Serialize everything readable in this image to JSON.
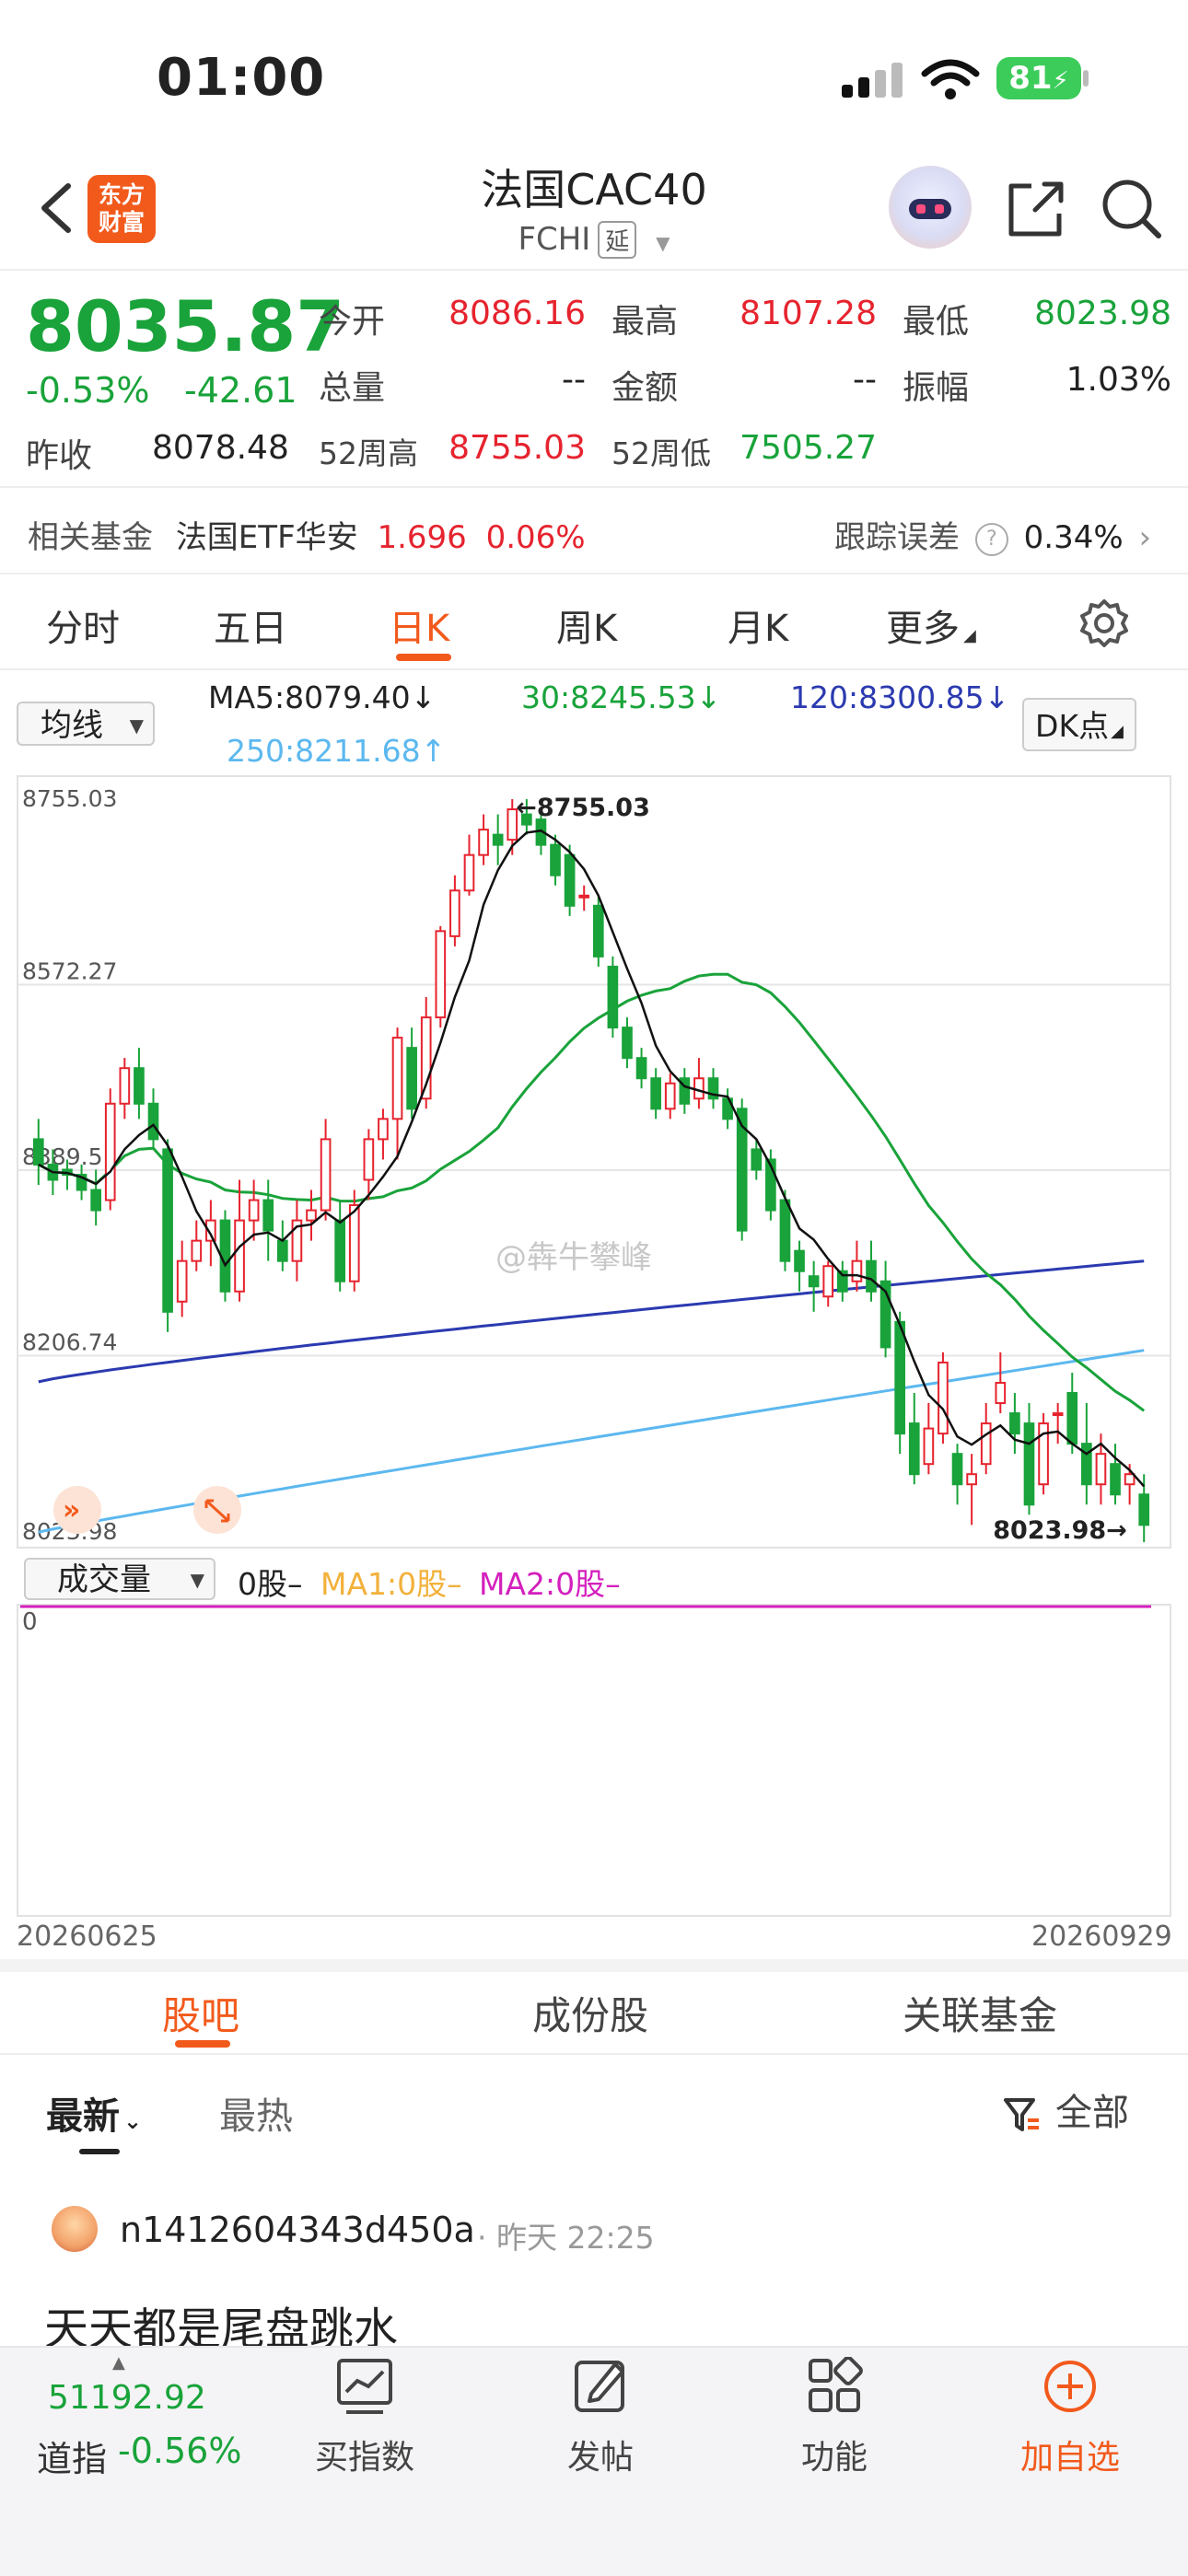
{
  "status_bar": {
    "time": "01:00",
    "battery": "81"
  },
  "header": {
    "logo_line1": "东方",
    "logo_line2": "财富",
    "title": "法国CAC40",
    "code": "FCHI",
    "delay_tag": "延"
  },
  "quote": {
    "price": "8035.87",
    "change_pct": "-0.53%",
    "change_abs": "-42.61",
    "prev_close_label": "昨收",
    "prev_close": "8078.48",
    "open_label": "今开",
    "open": "8086.16",
    "high_label": "最高",
    "high": "8107.28",
    "low_label": "最低",
    "low": "8023.98",
    "volume_label": "总量",
    "volume": "--",
    "amount_label": "金额",
    "amount": "--",
    "amplitude_label": "振幅",
    "amplitude": "1.03%",
    "wk52_high_label": "52周高",
    "wk52_high": "8755.03",
    "wk52_low_label": "52周低",
    "wk52_low": "7505.27"
  },
  "fund_row": {
    "label": "相关基金",
    "fund_name": "法国ETF华安",
    "fund_price": "1.696",
    "fund_change": "0.06%",
    "tracking_label": "跟踪误差",
    "tracking_value": "0.34%"
  },
  "period_tabs": [
    "分时",
    "五日",
    "日K",
    "周K",
    "月K",
    "更多"
  ],
  "active_period": "日K",
  "ma_row": {
    "selector": "均线",
    "ma5": "MA5:8079.40",
    "ma30": "30:8245.53",
    "ma120": "120:8300.85",
    "ma250": "250:8211.68",
    "arrow_down": "↓",
    "arrow_up": "↑",
    "dk_button": "DK点"
  },
  "chart_data": {
    "type": "candlestick",
    "y_ticks": [
      "8755.03",
      "8572.27",
      "8389.51",
      "8206.74",
      "8023.98"
    ],
    "ylim": [
      8023.98,
      8755.03
    ],
    "max_marker": "8755.03",
    "min_marker": "8023.98",
    "watermark": "@犇牛攀峰",
    "candles": [
      [
        8420,
        8395,
        8440,
        8375
      ],
      [
        8395,
        8380,
        8410,
        8365
      ],
      [
        8390,
        8385,
        8400,
        8370
      ],
      [
        8385,
        8370,
        8395,
        8360
      ],
      [
        8370,
        8350,
        8390,
        8335
      ],
      [
        8360,
        8455,
        8470,
        8350
      ],
      [
        8455,
        8490,
        8500,
        8440
      ],
      [
        8490,
        8455,
        8510,
        8440
      ],
      [
        8455,
        8420,
        8470,
        8410
      ],
      [
        8410,
        8250,
        8420,
        8230
      ],
      [
        8260,
        8300,
        8320,
        8245
      ],
      [
        8300,
        8320,
        8340,
        8290
      ],
      [
        8320,
        8340,
        8360,
        8295
      ],
      [
        8340,
        8270,
        8350,
        8260
      ],
      [
        8270,
        8340,
        8380,
        8260
      ],
      [
        8340,
        8360,
        8380,
        8320
      ],
      [
        8360,
        8330,
        8380,
        8300
      ],
      [
        8320,
        8300,
        8340,
        8290
      ],
      [
        8300,
        8340,
        8360,
        8280
      ],
      [
        8340,
        8350,
        8370,
        8320
      ],
      [
        8350,
        8420,
        8440,
        8340
      ],
      [
        8340,
        8280,
        8360,
        8270
      ],
      [
        8280,
        8355,
        8370,
        8270
      ],
      [
        8380,
        8420,
        8430,
        8360
      ],
      [
        8420,
        8440,
        8450,
        8400
      ],
      [
        8440,
        8520,
        8530,
        8400
      ],
      [
        8510,
        8450,
        8530,
        8440
      ],
      [
        8460,
        8540,
        8560,
        8450
      ],
      [
        8540,
        8625,
        8630,
        8530
      ],
      [
        8620,
        8665,
        8680,
        8610
      ],
      [
        8665,
        8700,
        8720,
        8660
      ],
      [
        8700,
        8725,
        8740,
        8690
      ],
      [
        8720,
        8710,
        8740,
        8690
      ],
      [
        8715,
        8745,
        8755,
        8700
      ],
      [
        8740,
        8730,
        8755,
        8720
      ],
      [
        8735,
        8710,
        8745,
        8700
      ],
      [
        8710,
        8680,
        8720,
        8670
      ],
      [
        8700,
        8650,
        8710,
        8640
      ],
      [
        8660,
        8660,
        8670,
        8645
      ],
      [
        8650,
        8600,
        8660,
        8590
      ],
      [
        8590,
        8530,
        8600,
        8520
      ],
      [
        8530,
        8500,
        8540,
        8490
      ],
      [
        8500,
        8480,
        8510,
        8470
      ],
      [
        8480,
        8450,
        8490,
        8440
      ],
      [
        8450,
        8475,
        8485,
        8440
      ],
      [
        8480,
        8455,
        8490,
        8445
      ],
      [
        8460,
        8480,
        8500,
        8450
      ],
      [
        8480,
        8460,
        8490,
        8450
      ],
      [
        8460,
        8440,
        8470,
        8430
      ],
      [
        8450,
        8330,
        8460,
        8320
      ],
      [
        8410,
        8390,
        8420,
        8380
      ],
      [
        8400,
        8350,
        8410,
        8340
      ],
      [
        8360,
        8300,
        8370,
        8290
      ],
      [
        8310,
        8290,
        8320,
        8270
      ],
      [
        8285,
        8275,
        8300,
        8250
      ],
      [
        8265,
        8295,
        8300,
        8255
      ],
      [
        8290,
        8270,
        8300,
        8260
      ],
      [
        8280,
        8300,
        8320,
        8270
      ],
      [
        8300,
        8270,
        8320,
        8260
      ],
      [
        8280,
        8215,
        8300,
        8205
      ],
      [
        8240,
        8130,
        8250,
        8110
      ],
      [
        8140,
        8090,
        8170,
        8080
      ],
      [
        8100,
        8135,
        8160,
        8090
      ],
      [
        8130,
        8200,
        8210,
        8120
      ],
      [
        8110,
        8080,
        8120,
        8060
      ],
      [
        8080,
        8090,
        8110,
        8040
      ],
      [
        8100,
        8140,
        8160,
        8090
      ],
      [
        8160,
        8180,
        8210,
        8150
      ],
      [
        8150,
        8130,
        8170,
        8110
      ],
      [
        8140,
        8060,
        8160,
        8050
      ],
      [
        8080,
        8140,
        8150,
        8070
      ],
      [
        8150,
        8150,
        8160,
        8120
      ],
      [
        8170,
        8120,
        8190,
        8110
      ],
      [
        8120,
        8080,
        8160,
        8060
      ],
      [
        8080,
        8110,
        8130,
        8060
      ],
      [
        8100,
        8070,
        8120,
        8060
      ],
      [
        8080,
        8090,
        8100,
        8060
      ],
      [
        8070,
        8040,
        8090,
        8023
      ]
    ]
  },
  "volume_row": {
    "selector": "成交量",
    "vol": "0股–",
    "ma1": "MA1:0股–",
    "ma2": "MA2:0股–",
    "axis_zero": "0"
  },
  "date_range": {
    "start": "20260625",
    "end": "20260929"
  },
  "bottom_tabs": [
    "股吧",
    "成份股",
    "关联基金"
  ],
  "sort_row": {
    "newest": "最新",
    "hottest": "最热",
    "filter": "全部"
  },
  "post": {
    "user": "n1412604343d450a",
    "time": "· 昨天 22:25",
    "text": "天天都是尾盘跳水"
  },
  "bottom_nav": {
    "index_value": "51192.92",
    "index_name": "道指",
    "index_pct": "-0.56%",
    "buy_index": "买指数",
    "post": "发帖",
    "functions": "功能",
    "add_watch": "加自选"
  },
  "colors": {
    "up": "#e6232e",
    "down": "#19a33a",
    "accent": "#f25a1c"
  }
}
